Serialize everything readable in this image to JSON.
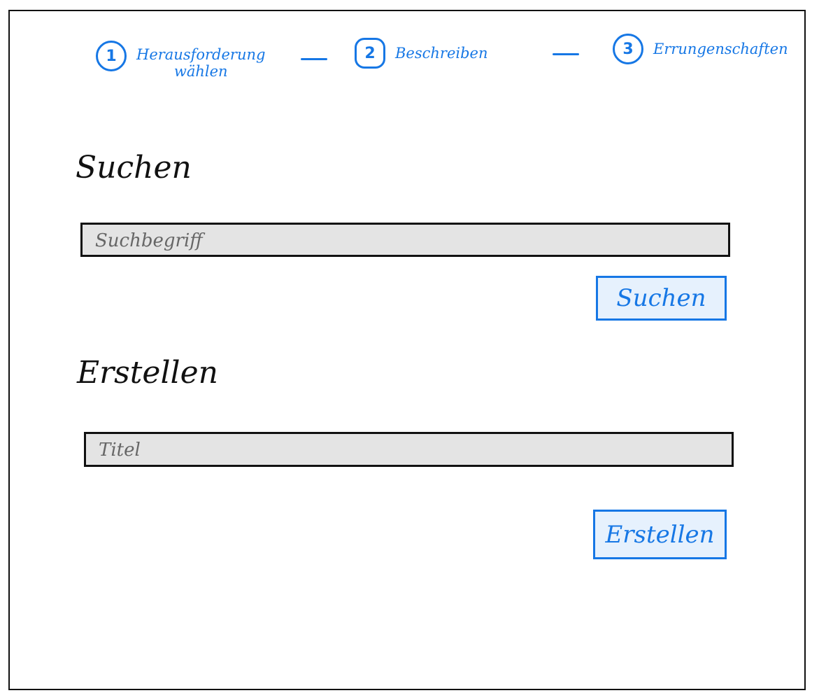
{
  "stepper": {
    "steps": [
      {
        "number": "1",
        "label": "Herausforderung\nwählen"
      },
      {
        "number": "2",
        "label": "Beschreiben"
      },
      {
        "number": "3",
        "label": "Errungenschaften"
      }
    ]
  },
  "search": {
    "heading": "Suchen",
    "input_placeholder": "Suchbegriff",
    "button_label": "Suchen"
  },
  "create": {
    "heading": "Erstellen",
    "input_placeholder": "Titel",
    "button_label": "Erstellen"
  },
  "colors": {
    "accent": "#1677e5",
    "input_bg": "#e4e4e4",
    "button_bg": "#e6f1fd"
  }
}
